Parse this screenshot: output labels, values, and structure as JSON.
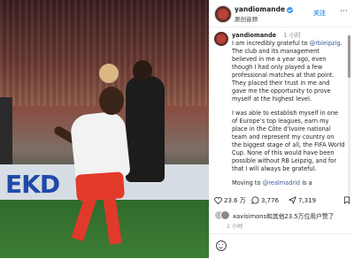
{
  "header": {
    "username": "yandiomande",
    "subtitle": "原创音频",
    "follow_label": "关注",
    "more": "⋯"
  },
  "post": {
    "username": "yandiomande",
    "intro": "I am incredibly grateful to ",
    "mention1": "@rbleipzig",
    "p1_rest": ". The club and its management believed in me a year ago, even though I had only played a few professional matches at that point. They placed their trust in me and gave me the opportunity to prove myself at the highest level.",
    "time": "1 小时",
    "p2": "I was able to establish myself in one of Europe’s top leagues, earn my place in the Côte d’Ivoire national team and represent my country on the biggest stage of all, the FIFA World Cup. None of this would have been possible without RB Leipzig, and for that I will always be grateful.",
    "p3_start": "Moving to ",
    "mention2": "@realmadrid",
    "p3_end": " is a"
  },
  "photo": {
    "ad_text": "EKD"
  },
  "actions": {
    "likes": "23.6 万",
    "comments": "3,776",
    "shares": "7,319"
  },
  "liked_by": {
    "text": "xavisimons和其他23.5万位用户赞了"
  },
  "post_time": "1 小时"
}
